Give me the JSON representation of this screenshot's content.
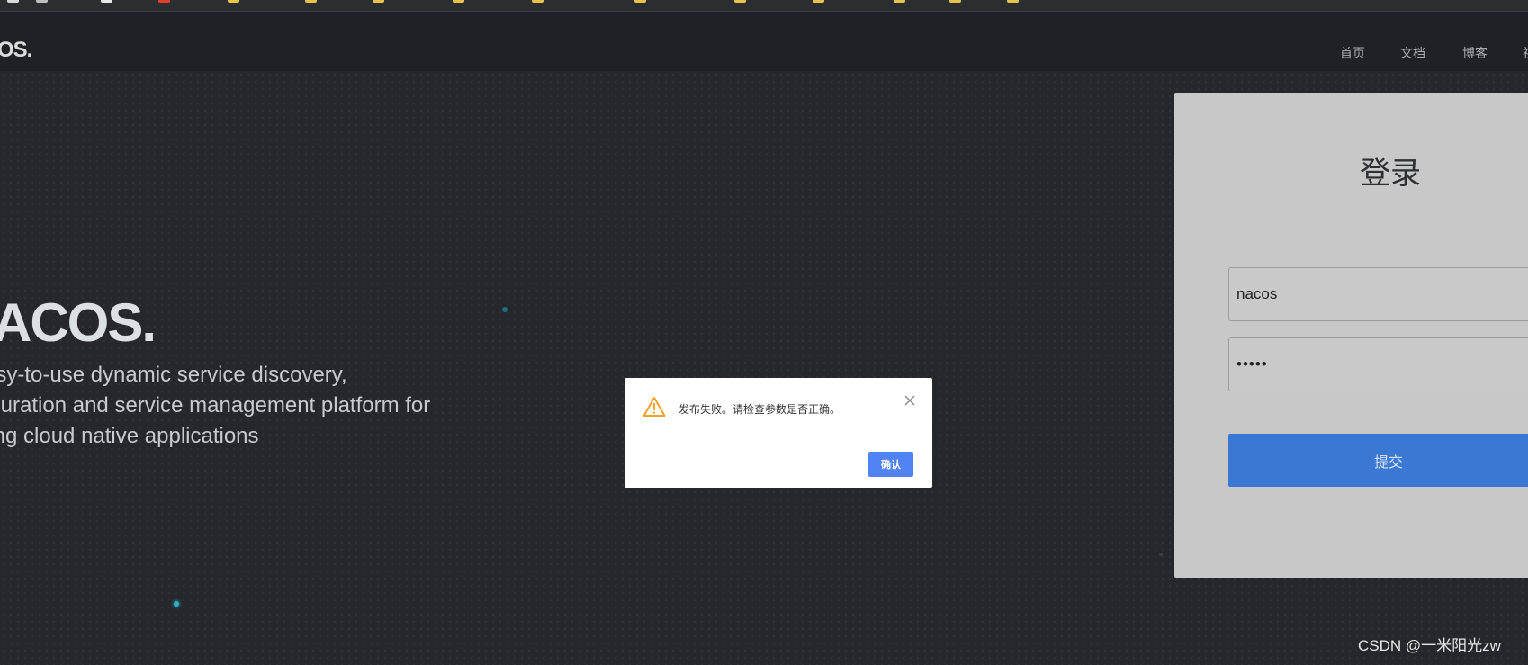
{
  "nav": {
    "logo": "OS.",
    "links": [
      "首页",
      "文档",
      "博客",
      "社"
    ]
  },
  "hero": {
    "brand": "ACOS.",
    "tagline": [
      "asy-to-use dynamic service discovery,",
      "iguration and service management platform for",
      "ling cloud native applications"
    ]
  },
  "login": {
    "title": "登录",
    "username_value": "nacos",
    "password_value": "•••••",
    "submit_label": "提交"
  },
  "dialog": {
    "message": "发布失败。请检查参数是否正确。",
    "confirm_label": "确认",
    "warn_color": "#f1a325"
  },
  "watermark": "CSDN @一米阳光zw",
  "colors": {
    "accent": "#3a78d4",
    "brand_dot": "#20a8c8",
    "bookmark_red": "#e0432a",
    "bookmark_yellow": "#e8c34a"
  }
}
